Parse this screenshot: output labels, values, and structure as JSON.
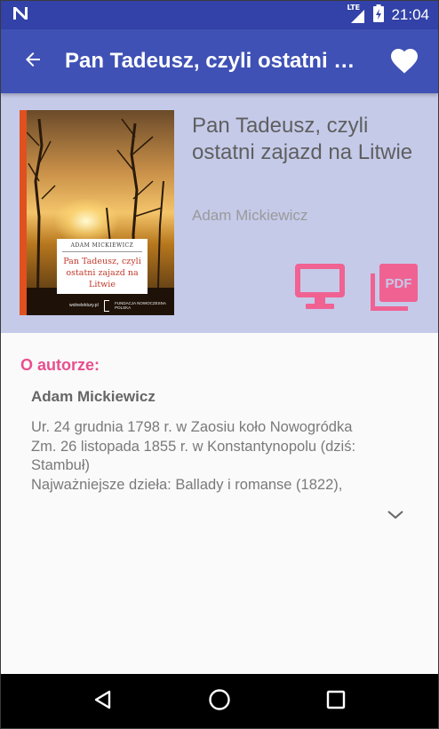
{
  "status_bar": {
    "network_label": "LTE",
    "time": "21:04",
    "icons": [
      "n-logo-icon",
      "signal-icon",
      "battery-charging-icon"
    ]
  },
  "app_bar": {
    "title": "Pan Tadeusz, czyli ostatni zajazd na Litwie",
    "back_icon": "arrow-back-icon",
    "favorite_icon": "heart-icon"
  },
  "book": {
    "title": "Pan Tadeusz, czyli ostatni zajazd na Litwie",
    "author": "Adam Mickiewicz",
    "cover": {
      "author": "ADAM MICKIEWICZ",
      "title": "Pan Tadeusz, czyli ostatni zajazd na Litwie",
      "footer_left": "wolnelektury.pl",
      "footer_right": "FUNDACJA NOWOCZESNA POLSKA"
    },
    "actions": [
      {
        "name": "read-online",
        "icon": "monitor-icon"
      },
      {
        "name": "download-pdf",
        "icon": "pdf-icon",
        "label": "PDF"
      }
    ]
  },
  "about": {
    "heading": "O autorze:",
    "name": "Adam Mickiewicz",
    "lines": [
      "Ur. 24 grudnia 1798 r. w Zaosiu koło Nowogródka",
      "Zm. 26 listopada 1855 r. w Konstantynopolu (dziś:",
      "Stambuł)",
      "Najważniejsze dzieła: Ballady i romanse (1822),"
    ],
    "expand_icon": "chevron-down-icon"
  },
  "nav_bar": {
    "buttons": [
      "back-triangle-icon",
      "home-circle-icon",
      "recents-square-icon"
    ]
  },
  "colors": {
    "primary_dark": "#3242a8",
    "primary": "#3f51b5",
    "header_bg": "#c5cae9",
    "accent": "#e84f8e",
    "action_icon": "#f06292"
  }
}
